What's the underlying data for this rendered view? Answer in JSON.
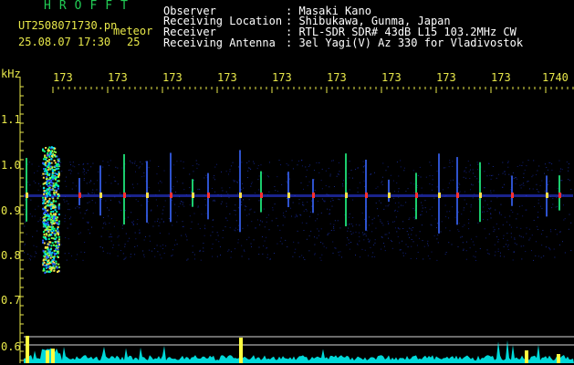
{
  "header": {
    "logo": "HROFFT",
    "file_name": "UT2508071730.pn",
    "meteor_label": "meteor",
    "datetime": "25.08.07 17:30",
    "count": "25"
  },
  "info": [
    {
      "label": "Observer",
      "value": ": Masaki Kano"
    },
    {
      "label": "Receiving Location",
      "value": ": Shibukawa, Gunma, Japan"
    },
    {
      "label": "Receiver",
      "value": ": RTL-SDR SDR# 43dB L15 103.2MHz CW"
    },
    {
      "label": "Receiving Antenna",
      "value": ": 3el Yagi(V) Az 330 for Vladivostok"
    }
  ],
  "axis": {
    "unit": "kHz",
    "freq_labels": [
      "1.1",
      "1.0",
      "0.9",
      "0.8",
      "0.7",
      "0.6"
    ],
    "time_labels": [
      "173",
      "173",
      "173",
      "173",
      "173",
      "173",
      "173",
      "173",
      "173",
      "1740"
    ]
  },
  "colors": {
    "text": "#e8e84a",
    "logo": "#22cc55",
    "background": "#000000",
    "spectrum_accent": "#00ffff"
  }
}
